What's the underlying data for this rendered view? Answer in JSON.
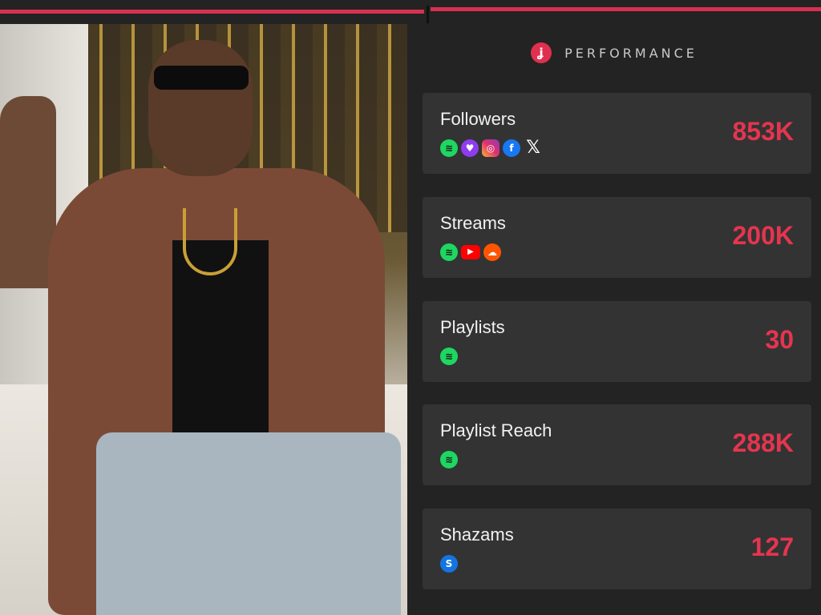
{
  "header": {
    "title": "PERFORMANCE",
    "brand_icon": "brand-logo-icon",
    "accent": "#e5354f"
  },
  "progress": {
    "fraction": 0.52
  },
  "metrics": [
    {
      "label": "Followers",
      "value": "853K",
      "icons": [
        "spotify-icon",
        "deezer-icon",
        "instagram-icon",
        "facebook-icon",
        "x-icon"
      ]
    },
    {
      "label": "Streams",
      "value": "200K",
      "icons": [
        "spotify-icon",
        "youtube-icon",
        "soundcloud-icon"
      ]
    },
    {
      "label": "Playlists",
      "value": "30",
      "icons": [
        "spotify-icon"
      ]
    },
    {
      "label": "Playlist Reach",
      "value": "288K",
      "icons": [
        "spotify-icon"
      ]
    },
    {
      "label": "Shazams",
      "value": "127",
      "icons": [
        "shazam-icon"
      ]
    }
  ]
}
